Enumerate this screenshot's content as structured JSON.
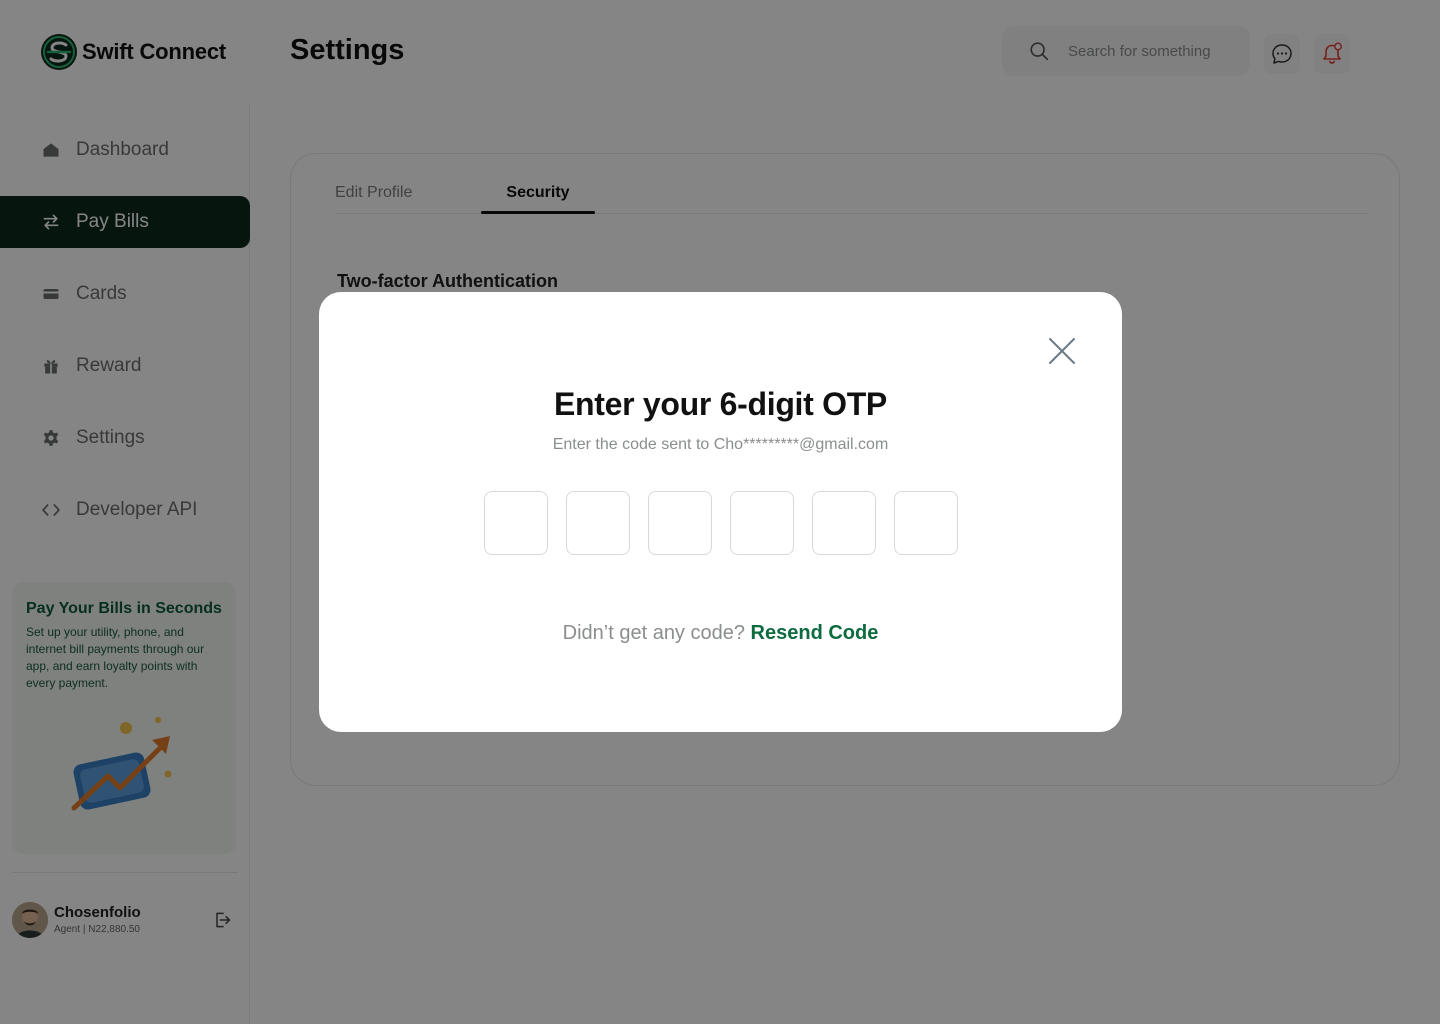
{
  "app": {
    "name": "Swift Connect",
    "page_title": "Settings"
  },
  "header": {
    "search_placeholder": "Search for something",
    "icons": [
      "search-icon",
      "chat-icon",
      "bell-icon"
    ]
  },
  "sidebar": {
    "items": [
      {
        "label": "Dashboard",
        "icon": "home-icon",
        "active": false
      },
      {
        "label": "Pay Bills",
        "icon": "transfer-icon",
        "active": true
      },
      {
        "label": "Cards",
        "icon": "card-icon",
        "active": false
      },
      {
        "label": "Reward",
        "icon": "gift-icon",
        "active": false
      },
      {
        "label": "Settings",
        "icon": "gear-icon",
        "active": false
      },
      {
        "label": "Developer API",
        "icon": "code-icon",
        "active": false
      }
    ],
    "promo": {
      "title": "Pay Your Bills in Seconds",
      "text": "Set up your utility, phone, and internet bill payments through our app, and earn loyalty points with every payment."
    },
    "profile": {
      "name": "Chosenfolio",
      "role": "Agent | N22,880.50"
    }
  },
  "settings": {
    "tabs": [
      {
        "label": "Edit Profile",
        "active": false
      },
      {
        "label": "Security",
        "active": true
      }
    ],
    "section_title": "Two-factor Authentication"
  },
  "modal": {
    "title": "Enter your 6-digit OTP",
    "subtitle": "Enter the code sent to Cho*********@gmail.com",
    "otp_values": [
      "",
      "",
      "",
      "",
      "",
      ""
    ],
    "resend_prompt": "Didn’t get any code?",
    "resend_link": "Resend Code"
  },
  "colors": {
    "brand_dark": "#0f2a1d",
    "brand_green": "#0d6b3f",
    "alert_red": "#e0403a"
  }
}
